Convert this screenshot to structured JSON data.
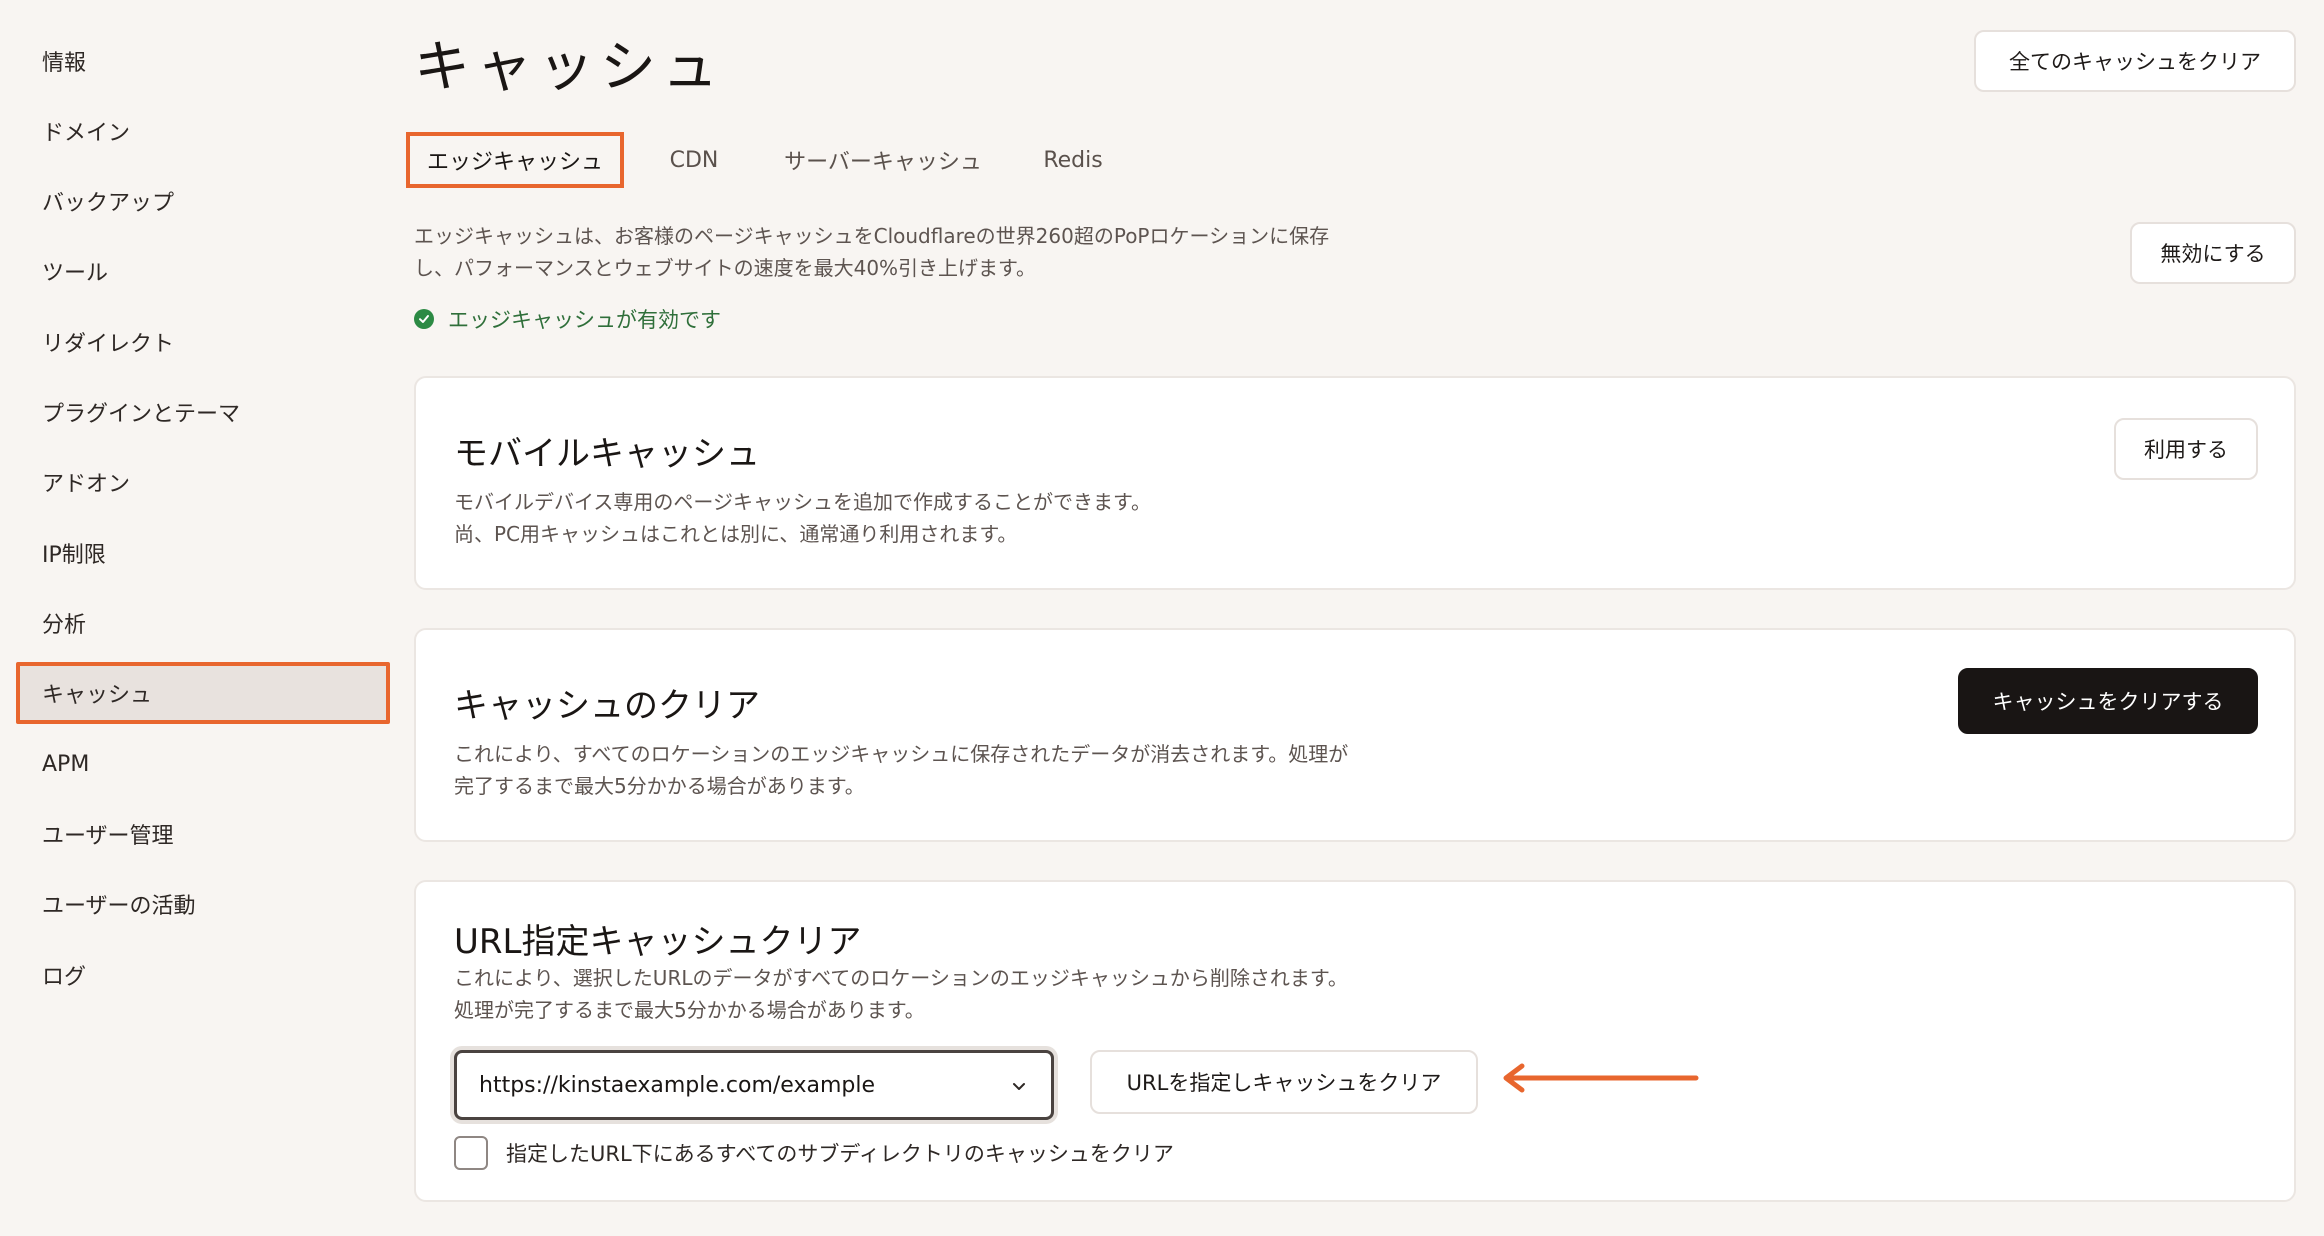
{
  "sidebar": {
    "items": [
      {
        "label": "情報"
      },
      {
        "label": "ドメイン"
      },
      {
        "label": "バックアップ"
      },
      {
        "label": "ツール"
      },
      {
        "label": "リダイレクト"
      },
      {
        "label": "プラグインとテーマ"
      },
      {
        "label": "アドオン"
      },
      {
        "label": "IP制限"
      },
      {
        "label": "分析"
      },
      {
        "label": "キャッシュ",
        "active": true
      },
      {
        "label": "APM"
      },
      {
        "label": "ユーザー管理"
      },
      {
        "label": "ユーザーの活動"
      },
      {
        "label": "ログ"
      }
    ]
  },
  "header": {
    "title": "キャッシュ",
    "clear_all_label": "全てのキャッシュをクリア"
  },
  "tabs": [
    {
      "label": "エッジキャッシュ",
      "active": true
    },
    {
      "label": "CDN"
    },
    {
      "label": "サーバーキャッシュ"
    },
    {
      "label": "Redis"
    }
  ],
  "edge": {
    "description_line1": "エッジキャッシュは、お客様のページキャッシュをCloudflareの世界260超のPoPロケーションに保存",
    "description_line2": "し、パフォーマンスとウェブサイトの速度を最大40%引き上げます。",
    "disable_label": "無効にする",
    "status_text": "エッジキャッシュが有効です",
    "status_color": "#2c8a44"
  },
  "mobile_cache": {
    "title": "モバイルキャッシュ",
    "line1": "モバイルデバイス専用のページキャッシュを追加で作成することができます。",
    "line2": "尚、PC用キャッシュはこれとは別に、通常通り利用されます。",
    "button_label": "利用する"
  },
  "clear_cache": {
    "title": "キャッシュのクリア",
    "line1": "これにより、すべてのロケーションのエッジキャッシュに保存されたデータが消去されます。処理が",
    "line2": "完了するまで最大5分かかる場合があります。",
    "button_label": "キャッシュをクリアする"
  },
  "url_clear": {
    "title": "URL指定キャッシュクリア",
    "line1": "これにより、選択したURLのデータがすべてのロケーションのエッジキャッシュから削除されます。",
    "line2": "処理が完了するまで最大5分かかる場合があります。",
    "url_value": "https://kinstaexample.com/example",
    "button_label": "URLを指定しキャッシュをクリア",
    "checkbox_label": "指定したURL下にあるすべてのサブディレクトリのキャッシュをクリア"
  },
  "colors": {
    "accent": "#e8662e",
    "background": "#f8f5f2",
    "primary_button": "#191514"
  },
  "icons": {
    "status": "check-circle-icon",
    "select": "chevron-down-icon",
    "annotation": "arrow-left-icon"
  }
}
